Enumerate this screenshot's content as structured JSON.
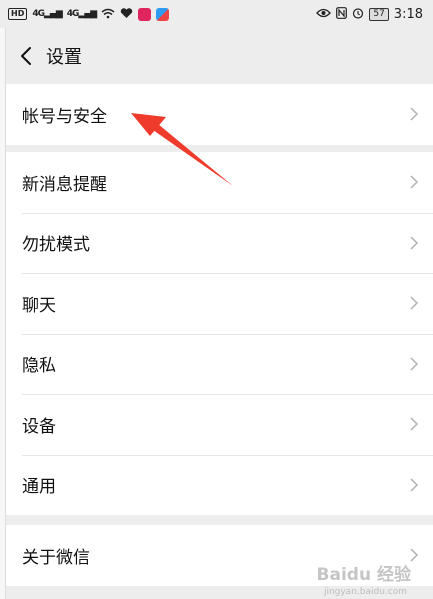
{
  "statusbar": {
    "hd": "HD",
    "sig1": "4G",
    "sig2": "4G",
    "battery": "57",
    "time": "3:18"
  },
  "header": {
    "title": "设置"
  },
  "settings": {
    "group1": [
      {
        "label": "帐号与安全"
      }
    ],
    "group2": [
      {
        "label": "新消息提醒"
      },
      {
        "label": "勿扰模式"
      },
      {
        "label": "聊天"
      },
      {
        "label": "隐私"
      },
      {
        "label": "设备"
      },
      {
        "label": "通用"
      }
    ],
    "group3": [
      {
        "label": "关于微信"
      }
    ]
  },
  "watermark": {
    "main": "Baidu 经验",
    "sub": "jingyan.baidu.com"
  },
  "colors": {
    "background": "#ededed",
    "row": "#ffffff",
    "annotation_arrow": "#ee3b2c"
  }
}
